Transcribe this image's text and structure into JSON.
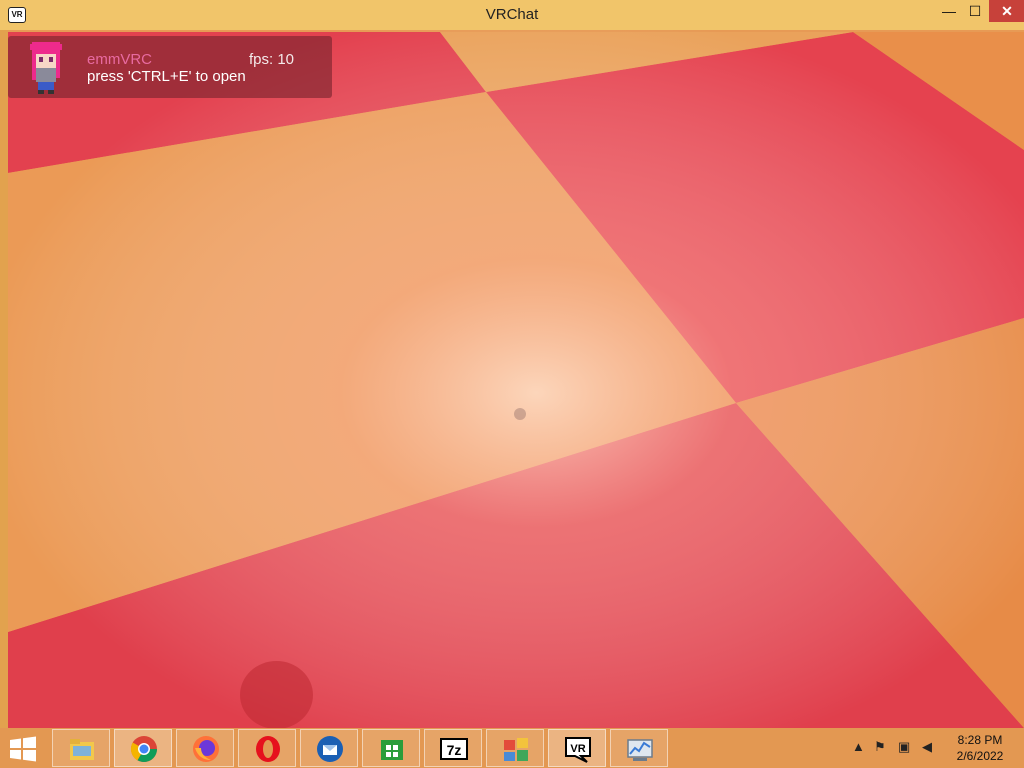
{
  "window": {
    "title": "VRChat",
    "icon_label": "VR"
  },
  "window_controls": {
    "minimize": "—",
    "maximize": "☐",
    "close": "✕"
  },
  "overlay": {
    "username": "emmVRC",
    "fps": "fps: 10",
    "hint": "press 'CTRL+E' to open"
  },
  "taskbar": {
    "items": [
      "file-explorer-icon",
      "chrome-icon",
      "firefox-icon",
      "opera-icon",
      "thunderbird-icon",
      "store-icon",
      "7zip-icon",
      "control-panel-icon",
      "vrchat-icon",
      "resource-monitor-icon"
    ],
    "active_item": "vrchat-icon",
    "sevenzip_label": "7z",
    "vr_label": "VR",
    "tray_icons": [
      "show-hidden-icon",
      "action-center-icon",
      "network-icon",
      "volume-muted-icon"
    ],
    "clock_time": "8:28 PM",
    "clock_date": "2/6/2022"
  },
  "colors": {
    "floor_red": "#e3414f",
    "floor_orange": "#e88f49",
    "highlight": "#ffd2bc",
    "titlebar": "#f1c56a",
    "taskbar": "#e39852"
  }
}
